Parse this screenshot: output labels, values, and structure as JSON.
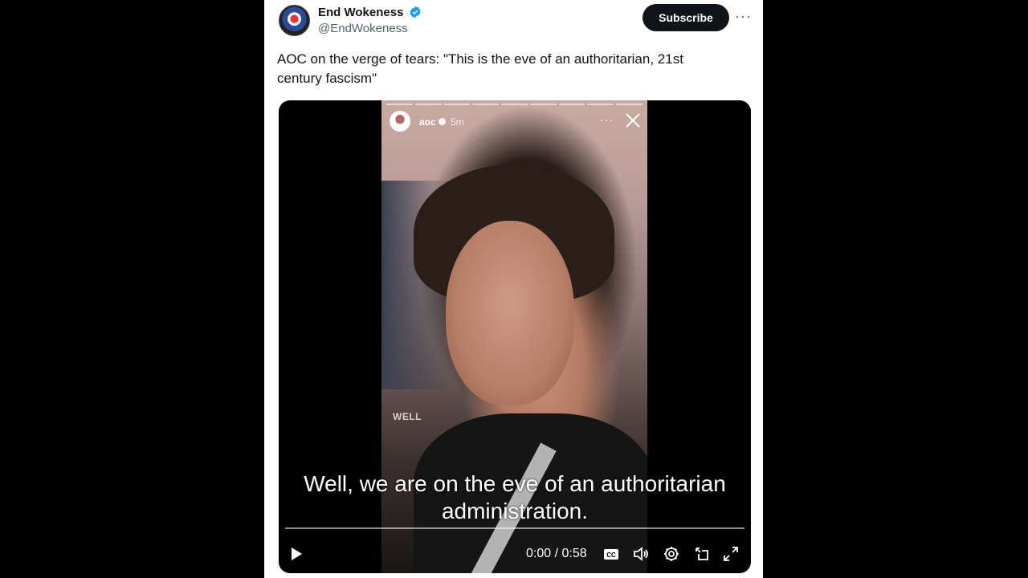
{
  "post": {
    "author_name": "End Wokeness",
    "author_handle": "@EndWokeness",
    "subscribe_label": "Subscribe",
    "more_label": "···",
    "text": "AOC on the verge of tears: \"This is the eve of an authoritarian, 21st century fascism\""
  },
  "video": {
    "story_user": "aoc",
    "story_time": "5m",
    "story_more": "···",
    "caption_small": "WELL",
    "subtitle_line1": "Well, we are on the eve of an authoritarian",
    "subtitle_line2": "administration.",
    "timecode": "0:00 / 0:58",
    "progress": 0
  },
  "colors": {
    "verified": "#1d9bf0",
    "text": "#0f1419",
    "secondary": "#536471"
  }
}
